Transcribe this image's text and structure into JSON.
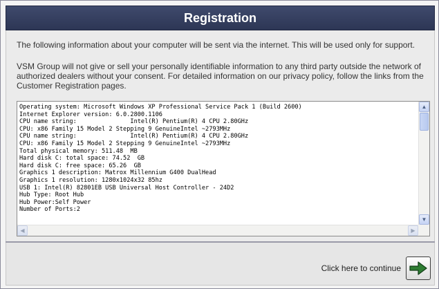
{
  "window": {
    "title": "Registration"
  },
  "intro": {
    "line1": "The following information about your computer will be sent via the internet. This will be used only for support.",
    "line2": "VSM Group will not give or sell your personally identifiable information to any third party outside the network of\nauthorized dealers without your consent. For detailed information on our privacy policy, follow the links from the\nCustomer Registration pages."
  },
  "system_info": {
    "lines": [
      "Operating system: Microsoft Windows XP Professional Service Pack 1 (Build 2600)",
      "Internet Explorer version: 6.0.2800.1106",
      "CPU name string:               Intel(R) Pentium(R) 4 CPU 2.80GHz",
      "CPU: x86 Family 15 Model 2 Stepping 9 GenuineIntel ~2793MHz",
      "CPU name string:               Intel(R) Pentium(R) 4 CPU 2.80GHz",
      "CPU: x86 Family 15 Model 2 Stepping 9 GenuineIntel ~2793MHz",
      "Total physical memory: 511.48  MB",
      "Hard disk C: total space: 74.52  GB",
      "Hard disk C: free space: 65.26  GB",
      "Graphics 1 description: Matrox Millennium G400 DualHead",
      "Graphics 1 resolution: 1280x1024x32 85hz",
      "USB 1: Intel(R) 82801EB USB Universal Host Controller - 24D2",
      "Hub Type: Root Hub",
      "Hub Power:Self Power",
      "Number of Ports:2"
    ]
  },
  "footer": {
    "continue_label": "Click here to continue"
  },
  "icons": {
    "continue": "right-arrow-icon",
    "scroll_up": "scroll-up-arrow-icon",
    "scroll_down": "scroll-down-arrow-icon",
    "scroll_left": "scroll-left-arrow-icon",
    "scroll_right": "scroll-right-arrow-icon"
  },
  "colors": {
    "title_bar": "#2f3858",
    "continue_arrow": "#2e7d32"
  }
}
